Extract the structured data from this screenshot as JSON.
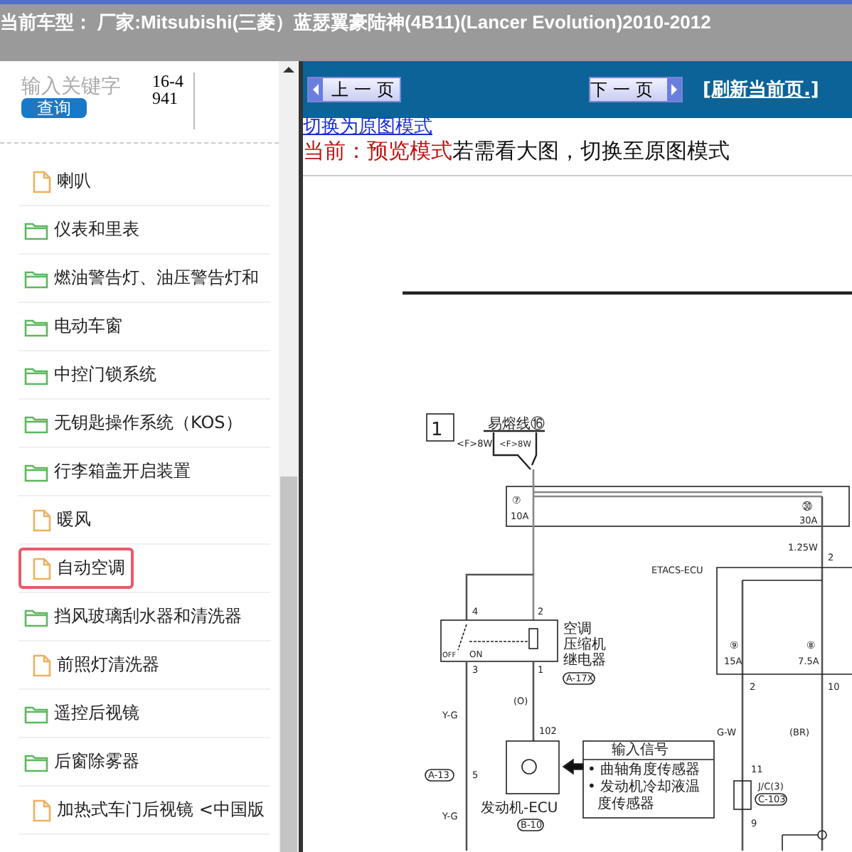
{
  "header": {
    "title": "当前车型：  厂家:Mitsubishi(三菱）蓝瑟翼豪陆神(4B11)(Lancer Evolution)2010-2012"
  },
  "sidebar": {
    "search": {
      "placeholder": "输入关键字"
    },
    "search_button": "查询",
    "page_ref": "16-4941",
    "items": [
      {
        "kind": "file",
        "label": "喇叭",
        "selected": false
      },
      {
        "kind": "folder",
        "label": "仪表和里表",
        "selected": false
      },
      {
        "kind": "folder",
        "label": "燃油警告灯、油压警告灯和",
        "selected": false
      },
      {
        "kind": "folder",
        "label": "电动车窗",
        "selected": false
      },
      {
        "kind": "folder",
        "label": "中控门锁系统",
        "selected": false
      },
      {
        "kind": "folder",
        "label": "无钥匙操作系统（KOS）",
        "selected": false
      },
      {
        "kind": "folder",
        "label": "行李箱盖开启装置",
        "selected": false
      },
      {
        "kind": "file",
        "label": "暖风",
        "selected": false
      },
      {
        "kind": "file",
        "label": "自动空调",
        "selected": true
      },
      {
        "kind": "folder",
        "label": "挡风玻璃刮水器和清洗器",
        "selected": false
      },
      {
        "kind": "file",
        "label": "前照灯清洗器",
        "selected": false
      },
      {
        "kind": "folder",
        "label": "遥控后视镜",
        "selected": false
      },
      {
        "kind": "folder",
        "label": "后窗除雾器",
        "selected": false
      },
      {
        "kind": "file",
        "label": "加热式车门后视镜 <中国版",
        "selected": false
      }
    ]
  },
  "toolbar": {
    "prev_button": "上一页",
    "next_button": "下一页",
    "refresh_link": "[刷新当前页.]"
  },
  "mode_link": "切换为原图模式",
  "mode_notice": {
    "current": "当前：预览模式",
    "hint": "若需看大图，切换至原图模式"
  },
  "diagram": {
    "labels": [
      "1",
      "易熔线⑯",
      "<F>8W",
      "<F>8W",
      "⑦",
      "10A",
      "㉚",
      "30A",
      "1.25W",
      "2",
      "ETACS-ECU",
      "4",
      "2",
      "空调",
      "压缩机",
      "继电器",
      "A-17X",
      "OFF",
      "ON",
      "3",
      "1",
      "(O)",
      "102",
      "Y-G",
      "A-13",
      "5",
      "Y-G",
      "发动机-ECU",
      "B-10",
      "输入信号",
      "• 曲轴角度传感器",
      "• 发动机冷却液温",
      "度传感器",
      "⑨",
      "15A",
      "⑧",
      "7.5A",
      "2",
      "10",
      "G-W",
      "(BR)",
      "11",
      "J/C(3)",
      "C-103",
      "9"
    ]
  }
}
